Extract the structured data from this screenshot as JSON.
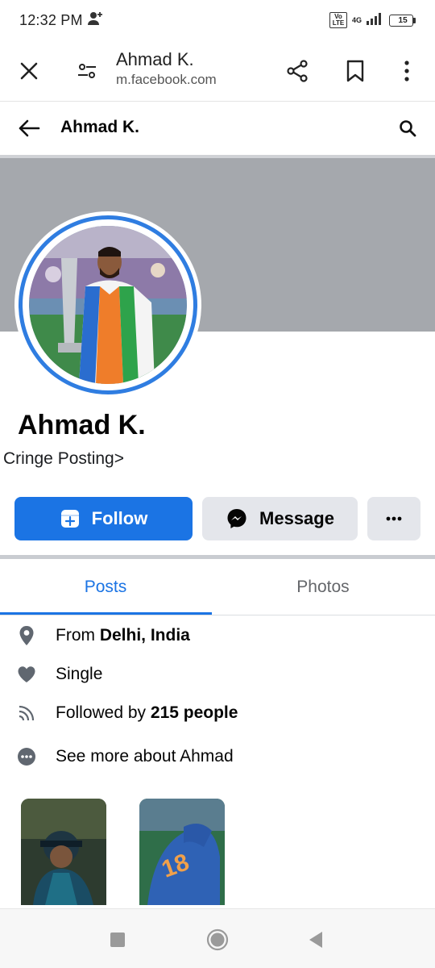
{
  "status_bar": {
    "time": "12:32 PM",
    "volte": "Vo LTE",
    "network": "4G",
    "battery": "15",
    "battery_level": 0.15
  },
  "browser": {
    "title": "Ahmad K.",
    "url": "m.facebook.com"
  },
  "header": {
    "title": "Ahmad K."
  },
  "profile": {
    "name": "Ahmad K.",
    "bio": "Cringe Posting>"
  },
  "actions": {
    "follow": "Follow",
    "message": "Message"
  },
  "tabs": [
    {
      "label": "Posts",
      "active": true
    },
    {
      "label": "Photos",
      "active": false
    }
  ],
  "intro": {
    "from_prefix": "From ",
    "from_value": "Delhi, India",
    "relationship": "Single",
    "followed_prefix": "Followed by ",
    "followed_value": "215 people",
    "see_more": "See more about Ahmad"
  },
  "icons": {
    "close": "close-icon",
    "settings": "site-settings-icon",
    "share": "share-icon",
    "bookmark": "bookmark-icon",
    "more": "more-vertical-icon",
    "back": "arrow-back-icon",
    "search": "search-icon",
    "follow": "add-friend-icon",
    "messenger": "messenger-icon",
    "location": "location-pin-icon",
    "heart": "heart-icon",
    "rss": "rss-icon",
    "ellipsis": "ellipsis-icon"
  },
  "colors": {
    "accent": "#1b74e4",
    "cover": "#a5a8ad",
    "button_secondary": "#e4e6eb"
  }
}
